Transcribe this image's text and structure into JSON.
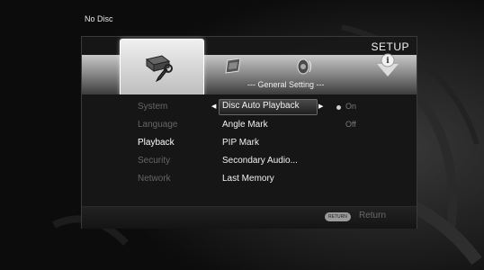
{
  "status": {
    "disc_text": "No Disc"
  },
  "header": {
    "title": "SETUP"
  },
  "section": {
    "title": "--- General Setting ---"
  },
  "categories": [
    {
      "label": "System",
      "active": false
    },
    {
      "label": "Language",
      "active": false
    },
    {
      "label": "Playback",
      "active": true
    },
    {
      "label": "Security",
      "active": false
    },
    {
      "label": "Network",
      "active": false
    }
  ],
  "options": [
    {
      "label": "Disc Auto Playback",
      "selected": true
    },
    {
      "label": "Angle Mark"
    },
    {
      "label": "PIP Mark"
    },
    {
      "label": "Secondary Audio..."
    },
    {
      "label": "Last Memory"
    }
  ],
  "values": {
    "on": "On",
    "off": "Off"
  },
  "footer": {
    "return_button": "RETURN",
    "return_label": "Return"
  },
  "icons": [
    "settings-tools-icon",
    "display-icon",
    "speaker-icon",
    "info-icon"
  ],
  "colors": {
    "panel": "#181818",
    "band_top": "#c8c8c8",
    "band_bottom": "#3c3c3c",
    "inactive_text": "#666666"
  }
}
